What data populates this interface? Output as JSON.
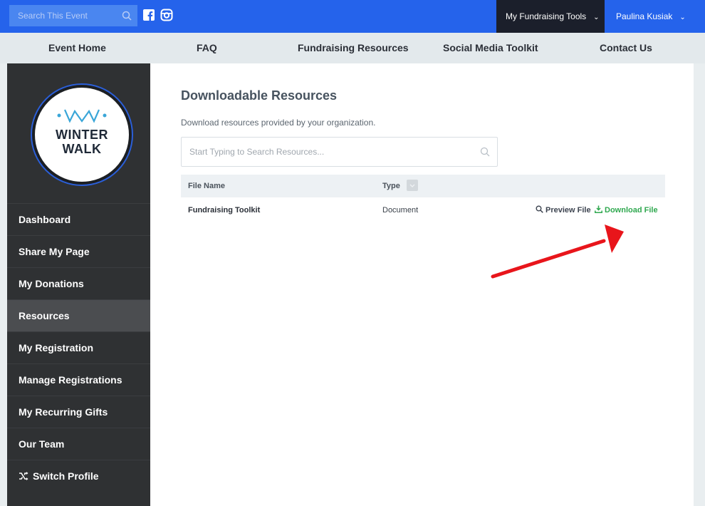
{
  "topbar": {
    "search_placeholder": "Search This Event",
    "tools_label": "My Fundraising Tools",
    "user_name": "Paulina Kusiak"
  },
  "nav": [
    "Event Home",
    "FAQ",
    "Fundraising Resources",
    "Social Media Toolkit",
    "Contact Us"
  ],
  "logo": {
    "line1": "WINTER",
    "line2": "WALK"
  },
  "sidebar": {
    "items": [
      {
        "label": "Dashboard"
      },
      {
        "label": "Share My Page"
      },
      {
        "label": "My Donations"
      },
      {
        "label": "Resources"
      },
      {
        "label": "My Registration"
      },
      {
        "label": "Manage Registrations"
      },
      {
        "label": "My Recurring Gifts"
      },
      {
        "label": "Our Team"
      },
      {
        "label": "Switch Profile"
      }
    ],
    "active": "Resources"
  },
  "main": {
    "heading": "Downloadable Resources",
    "subtext": "Download resources provided by your organization.",
    "search_placeholder": "Start Typing to Search Resources...",
    "columns": {
      "file_name": "File Name",
      "type": "Type"
    },
    "rows": [
      {
        "file_name": "Fundraising Toolkit",
        "type": "Document",
        "preview": "Preview File",
        "download": "Download File"
      }
    ]
  },
  "colors": {
    "brand": "#2563eb",
    "download": "#2fa84f",
    "annotation_arrow": "#e8151b"
  }
}
